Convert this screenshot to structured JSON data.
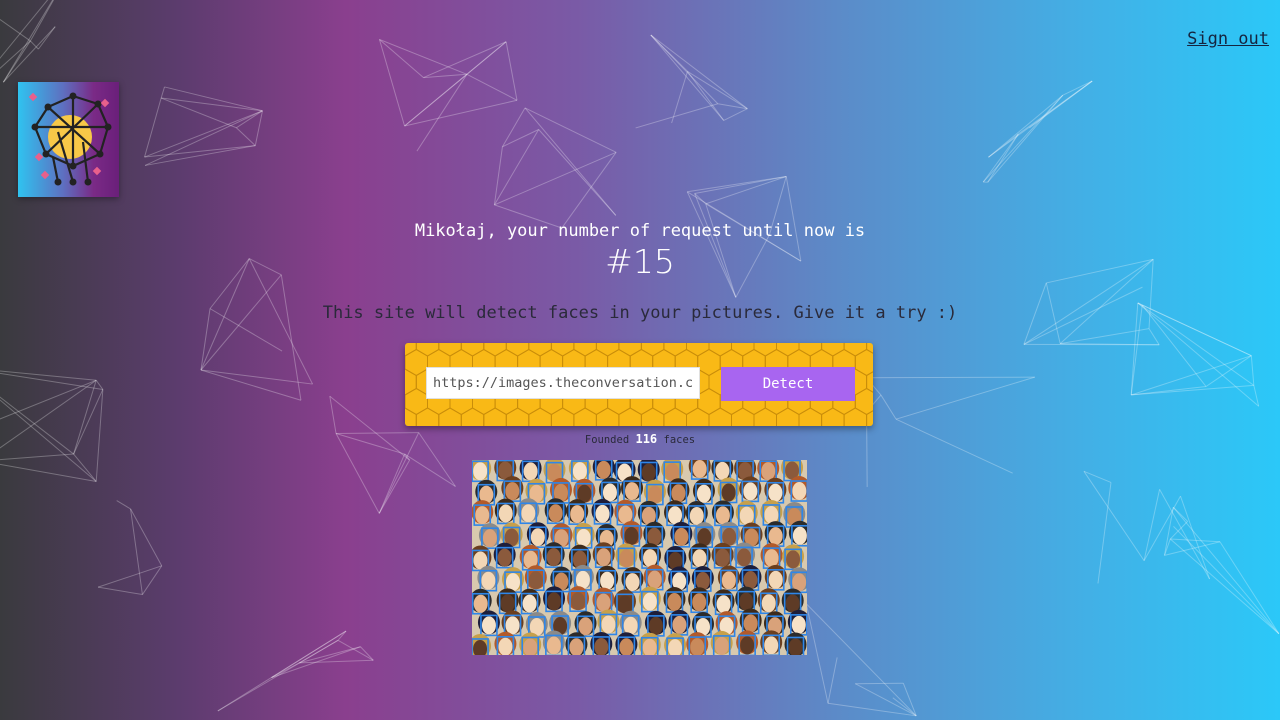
{
  "header": {
    "signout_label": "Sign out"
  },
  "user": {
    "greeting": "Mikołaj, your number of request until now is",
    "request_count": "#15"
  },
  "intro": {
    "description": "This site will detect faces in your pictures. Give it a try :)"
  },
  "form": {
    "url_value": "https://images.theconversation.com/",
    "detect_label": "Detect"
  },
  "result": {
    "found_prefix": "Founded",
    "face_count": "116",
    "found_suffix": "faces"
  },
  "colors": {
    "accent": "#a865f0",
    "panel": "#f9b916",
    "box": "#2f86e8"
  }
}
